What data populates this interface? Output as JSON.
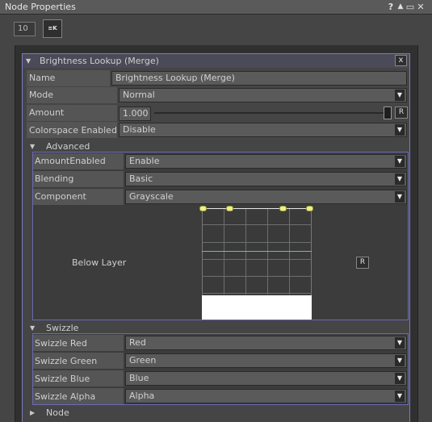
{
  "window": {
    "title": "Node Properties",
    "controls": [
      "?",
      "▲",
      "▭",
      "✕"
    ]
  },
  "toolbar": {
    "frame_value": "10",
    "cache_label": "≡K"
  },
  "node": {
    "title": "Brightness Lookup (Merge)",
    "close_label": "x",
    "name_label": "Name",
    "name_value": "Brightness Lookup (Merge)",
    "mode_label": "Mode",
    "mode_value": "Normal",
    "amount_label": "Amount",
    "amount_value": "1.000",
    "amount_reset": "R",
    "amount_level": 1.0,
    "colorspace_label": "Colorspace Enabled",
    "colorspace_value": "Disable"
  },
  "advanced": {
    "title": "Advanced",
    "amount_enabled_label": "AmountEnabled",
    "amount_enabled_value": "Enable",
    "blending_label": "Blending",
    "blending_value": "Basic",
    "component_label": "Component",
    "component_value": "Grayscale",
    "curve_label": "Below Layer",
    "curve_reset": "R"
  },
  "swizzle": {
    "title": "Swizzle",
    "red_label": "Swizzle Red",
    "red_value": "Red",
    "green_label": "Swizzle Green",
    "green_value": "Green",
    "blue_label": "Swizzle Blue",
    "blue_value": "Blue",
    "alpha_label": "Swizzle Alpha",
    "alpha_value": "Alpha"
  },
  "node_section": {
    "title": "Node"
  },
  "colors": {
    "panel_border": "#7b7bbd",
    "curve_line": "#5fd25f",
    "control_point": "#f0f088"
  }
}
